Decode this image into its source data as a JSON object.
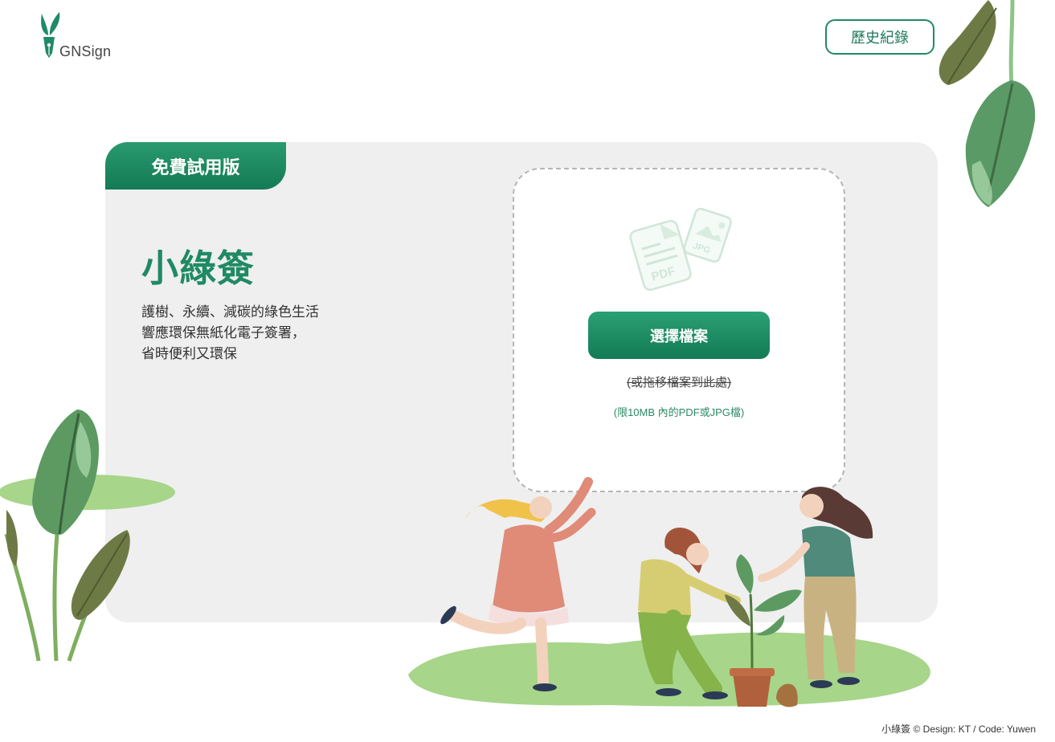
{
  "header": {
    "logo_text": "GNSign",
    "history_label": "歷史紀錄"
  },
  "card": {
    "badge": "免費試用版",
    "title": "小綠簽",
    "description": [
      "護樹、永續、減碳的綠色生活",
      "響應環保無紙化電子簽署，",
      "省時便利又環保"
    ]
  },
  "upload": {
    "icon_labels": [
      "PDF",
      "JPG"
    ],
    "choose_label": "選擇檔案",
    "drag_hint": "(或拖移檔案到此處)",
    "limit_hint": "(限10MB 內的PDF或JPG檔)"
  },
  "footer": {
    "credit": "小綠簽 © Design: KT / Code: Yuwen"
  },
  "colors": {
    "brand_green": "#1f8a64",
    "card_bg": "#efefef",
    "leaf_light": "#a7d58a"
  }
}
